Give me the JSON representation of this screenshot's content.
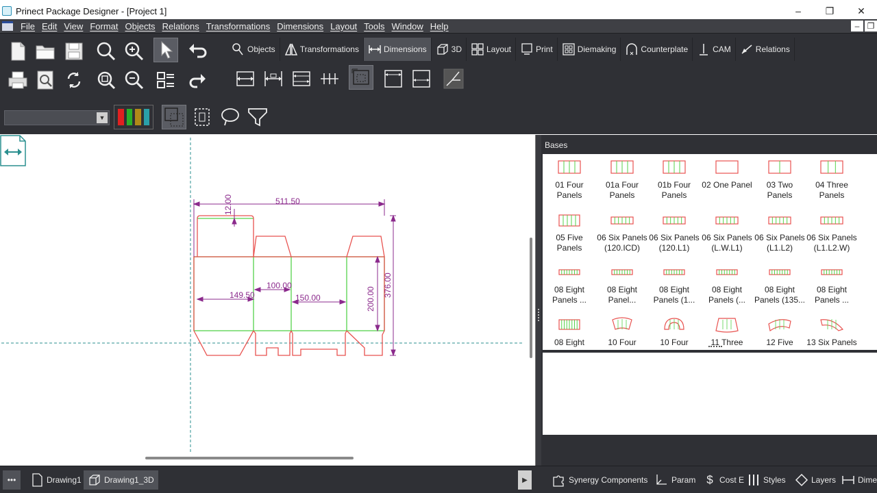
{
  "window": {
    "title": "Prinect Package Designer - [Project 1]",
    "controls": {
      "minimize": "–",
      "maximize": "❐",
      "close": "✕"
    }
  },
  "menu": [
    "File",
    "Edit",
    "View",
    "Format",
    "Objects",
    "Relations",
    "Transformations",
    "Dimensions",
    "Layout",
    "Tools",
    "Window",
    "Help"
  ],
  "mdi_controls": {
    "minimize": "–",
    "restore": "❐"
  },
  "tabs": [
    "Objects",
    "Transformations",
    "Dimensions",
    "3D",
    "Layout",
    "Print",
    "Diemaking",
    "Counterplate",
    "CAM",
    "Relations"
  ],
  "active_tab": "Dimensions",
  "colors": {
    "cut_line": "#e8524f",
    "crease_line": "#55d24a",
    "dimension": "#8b2a8c",
    "guide": "#2a8f8f",
    "toolbar_bg": "#2f3035"
  },
  "color_chips": [
    "#e02020",
    "#28b028",
    "#b08a18",
    "#2aa0a8"
  ],
  "drawing": {
    "dimensions": {
      "overall_width": "511.50",
      "tuck_flap": "12.00",
      "panel_1": "149.50",
      "panel_2": "100.00",
      "panel_3": "150.00",
      "body_height": "200.00",
      "overall_height": "376.00"
    }
  },
  "bases_panel": {
    "title": "Bases",
    "items": [
      {
        "label": "01 Four Panels"
      },
      {
        "label": "01a Four Panels"
      },
      {
        "label": "01b Four Panels"
      },
      {
        "label": "02 One Panel"
      },
      {
        "label": "03 Two Panels"
      },
      {
        "label": "04 Three Panels"
      },
      {
        "label": "05 Five Panels"
      },
      {
        "label": "06 Six Panels (120.ICD)"
      },
      {
        "label": "06 Six Panels (120.L1)"
      },
      {
        "label": "06 Six Panels (L.W.L1)"
      },
      {
        "label": "06 Six Panels (L1.L2)"
      },
      {
        "label": "06 Six Panels (L1.L2.W)"
      },
      {
        "label": "08 Eight Panels ..."
      },
      {
        "label": "08 Eight Panel..."
      },
      {
        "label": "08 Eight Panels (1..."
      },
      {
        "label": "08 Eight Panels (..."
      },
      {
        "label": "08 Eight Panels (135..."
      },
      {
        "label": "08 Eight Panels ..."
      },
      {
        "label": "08 Eight"
      },
      {
        "label": "10 Four"
      },
      {
        "label": "10 Four"
      },
      {
        "label": "11 Three"
      },
      {
        "label": "12 Five"
      },
      {
        "label": "13 Six Panels"
      }
    ]
  },
  "bottom_tabs": {
    "left": [
      "Drawing1",
      "Drawing1_3D"
    ],
    "right": [
      "Synergy Components",
      "Param",
      "Cost E",
      "Styles",
      "Layers",
      "Dimen"
    ]
  }
}
